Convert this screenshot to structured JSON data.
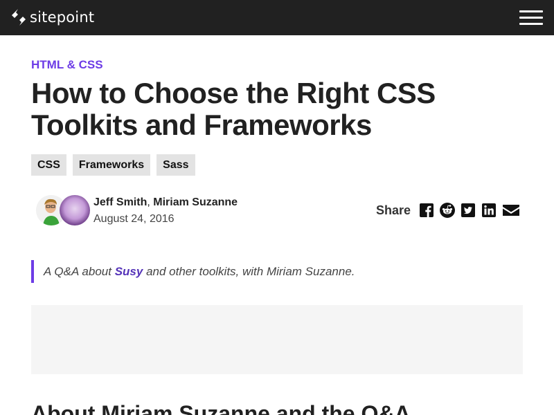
{
  "header": {
    "logo_text": "sitepoint",
    "menu_icon": "hamburger-menu-icon",
    "bg_color": "#212121"
  },
  "article": {
    "category": "HTML & CSS",
    "title": "How to Choose the Right CSS Toolkits and Frameworks",
    "tags": [
      "CSS",
      "Frameworks",
      "Sass"
    ],
    "authors": {
      "author1": "Jeff Smith",
      "separator": ",",
      "author2": "Miriam Suzanne",
      "date": "August 24, 2016"
    },
    "share": {
      "label": "Share",
      "icons": [
        "facebook-icon",
        "reddit-icon",
        "twitter-icon",
        "linkedin-icon",
        "email-icon"
      ]
    },
    "lede": {
      "before": "A Q&A about",
      "link": "Susy",
      "after": "and other toolkits, with Miriam Suzanne."
    },
    "section_heading": "About Miriam Suzanne and the Q&A"
  },
  "colors": {
    "accent": "#6d3ce6",
    "link": "#5432b8",
    "tag_bg": "#e3e3e3"
  }
}
